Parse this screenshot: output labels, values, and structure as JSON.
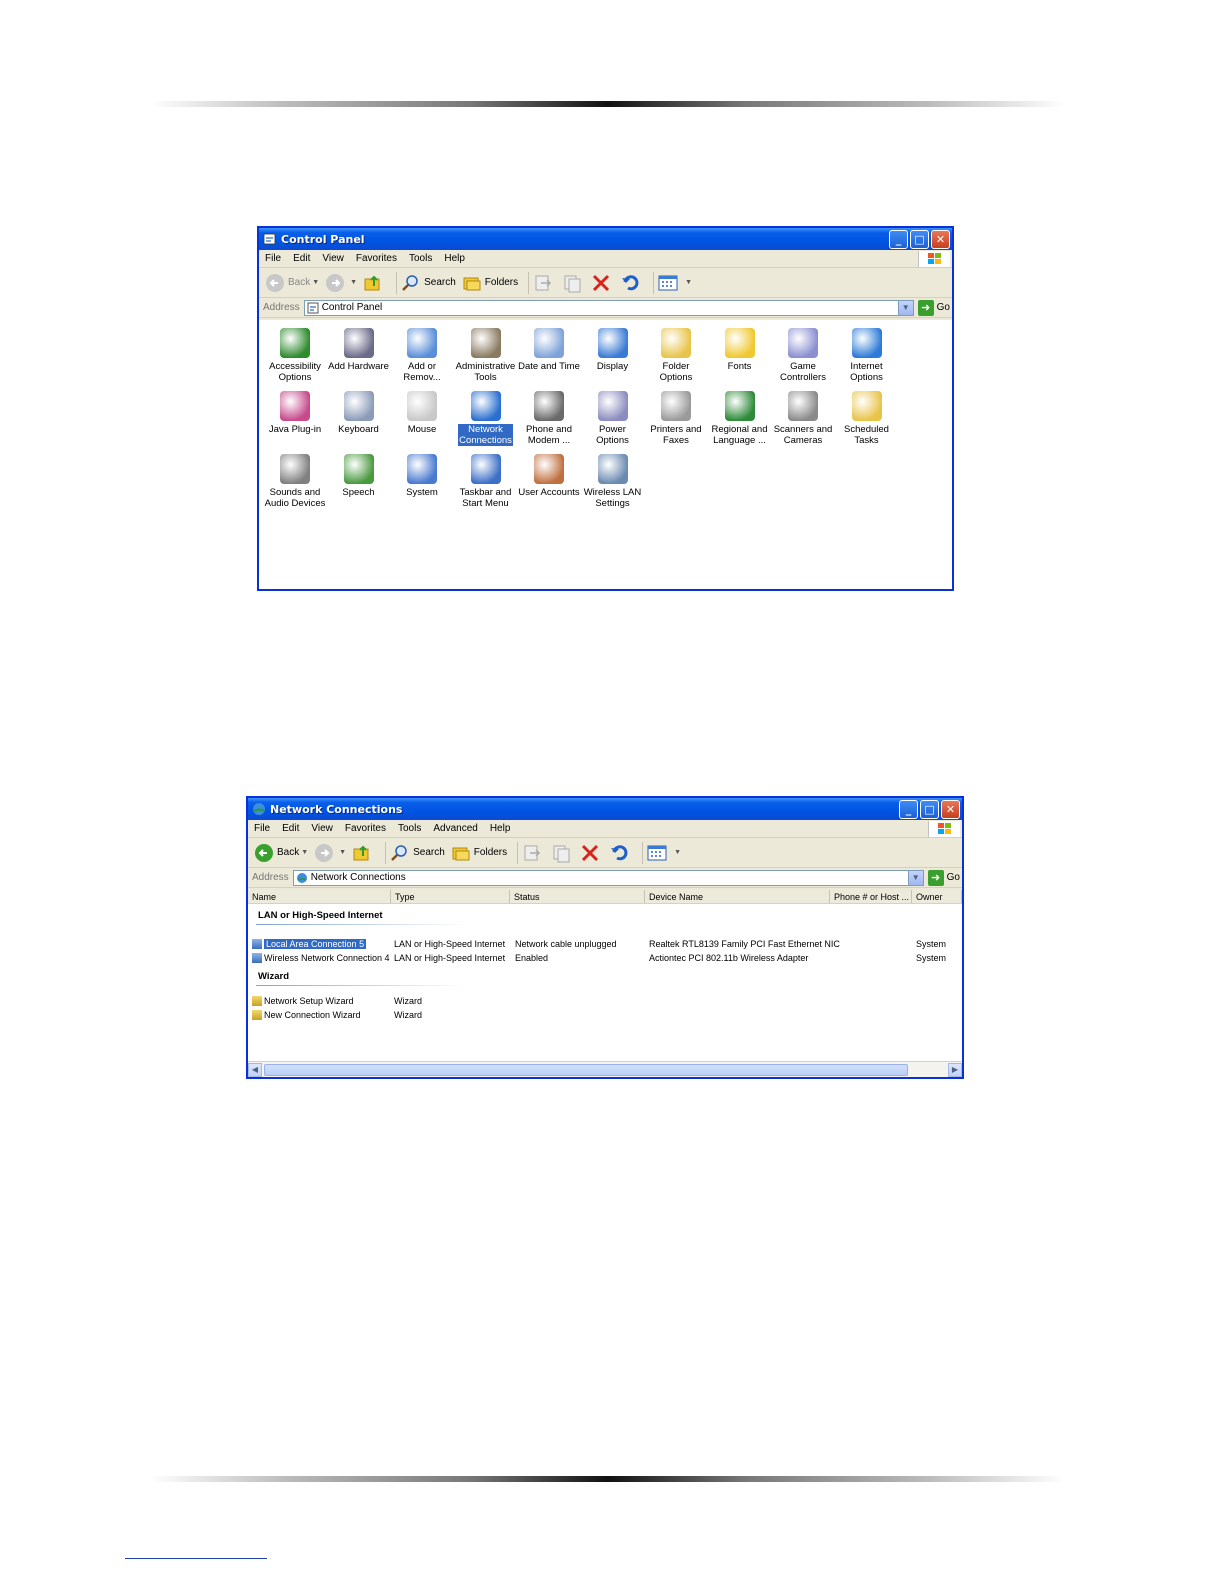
{
  "control_panel": {
    "title": "Control Panel",
    "menu": [
      "File",
      "Edit",
      "View",
      "Favorites",
      "Tools",
      "Help"
    ],
    "toolbar": {
      "back": "Back",
      "search": "Search",
      "folders": "Folders"
    },
    "address": {
      "label": "Address",
      "value": "Control Panel",
      "go": "Go"
    },
    "items": [
      {
        "line1": "Accessibility",
        "line2": "Options",
        "color": "#2e8b2e"
      },
      {
        "line1": "Add Hardware",
        "line2": "",
        "color": "#6a6a8a"
      },
      {
        "line1": "Add or",
        "line2": "Remov...",
        "color": "#5a8fd8"
      },
      {
        "line1": "Administrative",
        "line2": "Tools",
        "color": "#8a7a60"
      },
      {
        "line1": "Date and Time",
        "line2": "",
        "color": "#7fa3d9"
      },
      {
        "line1": "Display",
        "line2": "",
        "color": "#3a7bd5"
      },
      {
        "line1": "Folder Options",
        "line2": "",
        "color": "#e8c44a"
      },
      {
        "line1": "Fonts",
        "line2": "",
        "color": "#f0c830"
      },
      {
        "line1": "Game",
        "line2": "Controllers",
        "color": "#8a8fd0"
      },
      {
        "line1": "Internet",
        "line2": "Options",
        "color": "#2d7bd8"
      },
      {
        "line1": "Java Plug-in",
        "line2": "",
        "color": "#c64a8c"
      },
      {
        "line1": "Keyboard",
        "line2": "",
        "color": "#8b9bb8"
      },
      {
        "line1": "Mouse",
        "line2": "",
        "color": "#c8c8c8"
      },
      {
        "line1": "Network",
        "line2": "Connections",
        "color": "#2a6fd0"
      },
      {
        "line1": "Phone and",
        "line2": "Modem ...",
        "color": "#6a6a6a"
      },
      {
        "line1": "Power Options",
        "line2": "",
        "color": "#8c8cc0"
      },
      {
        "line1": "Printers and",
        "line2": "Faxes",
        "color": "#9a9a9a"
      },
      {
        "line1": "Regional and",
        "line2": "Language ...",
        "color": "#2f8a3a"
      },
      {
        "line1": "Scanners and",
        "line2": "Cameras",
        "color": "#8a8a8a"
      },
      {
        "line1": "Scheduled",
        "line2": "Tasks",
        "color": "#e8c44a"
      },
      {
        "line1": "Sounds and",
        "line2": "Audio Devices",
        "color": "#808080"
      },
      {
        "line1": "Speech",
        "line2": "",
        "color": "#4a9a40"
      },
      {
        "line1": "System",
        "line2": "",
        "color": "#4a7ad0"
      },
      {
        "line1": "Taskbar and",
        "line2": "Start Menu",
        "color": "#3c6fc8"
      },
      {
        "line1": "User Accounts",
        "line2": "",
        "color": "#c07040"
      },
      {
        "line1": "Wireless LAN",
        "line2": "Settings",
        "color": "#6a8ab0"
      }
    ],
    "selected_item": "Network Connections"
  },
  "network_connections": {
    "title": "Network Connections",
    "menu": [
      "File",
      "Edit",
      "View",
      "Favorites",
      "Tools",
      "Advanced",
      "Help"
    ],
    "toolbar": {
      "back": "Back",
      "search": "Search",
      "folders": "Folders"
    },
    "address": {
      "label": "Address",
      "value": "Network Connections",
      "go": "Go"
    },
    "columns": [
      "Name",
      "Type",
      "Status",
      "Device Name",
      "Phone # or Host ...",
      "Owner"
    ],
    "groups": [
      {
        "label": "LAN or High-Speed Internet",
        "rows": [
          {
            "name": "Local Area Connection 5",
            "type": "LAN or High-Speed Internet",
            "status": "Network cable unplugged",
            "device": "Realtek RTL8139 Family PCI Fast Ethernet NIC",
            "phone": "",
            "owner": "System",
            "selected": true
          },
          {
            "name": "Wireless Network Connection 4",
            "type": "LAN or High-Speed Internet",
            "status": "Enabled",
            "device": "Actiontec PCI 802.11b Wireless Adapter",
            "phone": "",
            "owner": "System",
            "selected": false
          }
        ]
      },
      {
        "label": "Wizard",
        "rows": [
          {
            "name": "Network Setup Wizard",
            "type": "Wizard",
            "status": "",
            "device": "",
            "phone": "",
            "owner": "",
            "selected": false
          },
          {
            "name": "New Connection Wizard",
            "type": "Wizard",
            "status": "",
            "device": "",
            "phone": "",
            "owner": "",
            "selected": false
          }
        ]
      }
    ]
  }
}
